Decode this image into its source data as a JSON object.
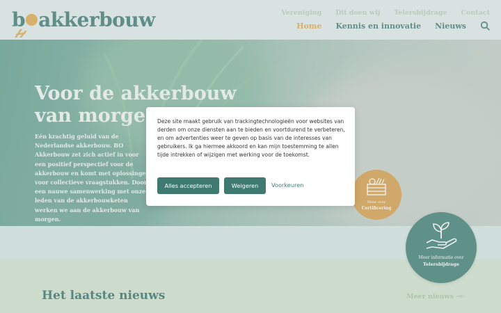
{
  "header": {
    "logo_text_before": "b",
    "logo_text_after": "akkerbouw",
    "top_nav": [
      "Vereniging",
      "Dit doen wij",
      "Telersbijdrage",
      "Contact"
    ],
    "main_nav": [
      "Home",
      "Kennis en innovatie",
      "Nieuws"
    ],
    "active_nav": "Home"
  },
  "hero": {
    "title_line1": "Voor de akkerbouw",
    "title_line2": "van morgen",
    "text": "Eén krachtig geluid van de Nederlandse akkerbouw. BO Akkerbouw zet zich actief in voor een positief perspectief voor de akkerbouw en komt met oplossingen voor collectieve vraagstukken. Door een nauwe samenwerking met onze leden van de akkerbouwketen werken we aan de akkerbouw van morgen."
  },
  "badges": {
    "certification": {
      "line1": "Meer over",
      "line2": "Certificering",
      "icon": "crate-of-vegetables-icon"
    },
    "telersbijdrage": {
      "line1": "Meer informatie over",
      "line2": "Telersbijdrage",
      "icon": "hand-holding-sprout-icon"
    }
  },
  "news": {
    "title": "Het laatste nieuws",
    "more_label": "Meer nieuws"
  },
  "cookie": {
    "text": "Deze site maakt gebruik van trackingtechnologieën voor websites van derden om onze diensten aan te bieden en voortdurend te verbeteren, en om advertenties weer te geven op basis van de interesses van gebruikers. Ik ga hiermee akkoord en kan mijn toestemming te allen tijde intrekken of wijzigen met werking voor de toekomst.",
    "accept_label": "Alles accepteren",
    "decline_label": "Weigeren",
    "prefs_label": "Voorkeuren"
  },
  "colors": {
    "brand_teal": "#3d7570",
    "brand_orange": "#e3a64a",
    "button": "#3f7a70"
  }
}
